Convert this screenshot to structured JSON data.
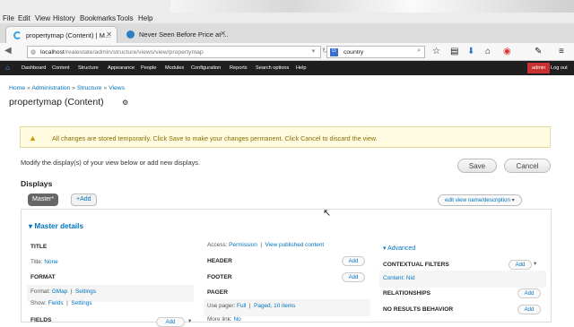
{
  "menubar": {
    "file": "File",
    "edit": "Edit",
    "view": "View",
    "history": "History",
    "bookmarks": "Bookmarks",
    "tools": "Tools",
    "help": "Help"
  },
  "tabs": [
    {
      "label": "propertymap (Content) | M..."
    },
    {
      "label": "Never Seen Before Price at ..."
    }
  ],
  "nav": {
    "url_host": "localhost",
    "url_path": "/realestate/admin/structure/views/view/propertymap",
    "search_value": "country"
  },
  "adminbar": {
    "items": [
      "Dashboard",
      "Content",
      "Structure",
      "Appearance",
      "People",
      "Modules",
      "Configuration",
      "Reports",
      "Search options",
      "Help"
    ],
    "user": "admin",
    "logout": "Log out"
  },
  "breadcrumb": [
    "Home",
    "Administration",
    "Structure",
    "Views"
  ],
  "page_title": "propertymap (Content)",
  "warning": "All changes are stored temporarily. Click Save to make your changes permanent. Click Cancel to discard the view.",
  "modify_text": "Modify the display(s) of your view below or add new displays.",
  "buttons": {
    "save": "Save",
    "cancel": "Cancel"
  },
  "displays": {
    "heading": "Displays",
    "master": "Master*",
    "add": "+Add",
    "edit_name": "edit view name/description"
  },
  "master_details": "Master details",
  "col1": {
    "title_h": "TITLE",
    "title_label": "Title:",
    "title_value": "None",
    "format_h": "FORMAT",
    "format_label": "Format:",
    "format_value": "GMap",
    "format_settings": "Settings",
    "show_label": "Show:",
    "show_value": "Fields",
    "show_settings": "Settings",
    "fields_h": "FIELDS",
    "fields_add": "Add"
  },
  "col2": {
    "access_label": "Access:",
    "access_value": "Permission",
    "published": "View published content",
    "header_h": "HEADER",
    "header_add": "Add",
    "footer_h": "FOOTER",
    "footer_add": "Add",
    "pager_h": "PAGER",
    "use_pager_label": "Use pager:",
    "use_pager_value": "Full",
    "use_pager_items": "Paged, 10 items",
    "more_link_label": "More link:",
    "more_link_value": "No"
  },
  "col3": {
    "advanced": "Advanced",
    "ctx_h": "CONTEXTUAL FILTERS",
    "ctx_add": "Add",
    "content_nid": "Content: Nid",
    "rel_h": "RELATIONSHIPS",
    "rel_add": "Add",
    "nores_h": "NO RESULTS BEHAVIOR",
    "nores_add": "Add"
  },
  "colors": {
    "accent": "#0074bd",
    "adminbar": "#1f1f1f",
    "warning_bg": "#fefbe0"
  }
}
